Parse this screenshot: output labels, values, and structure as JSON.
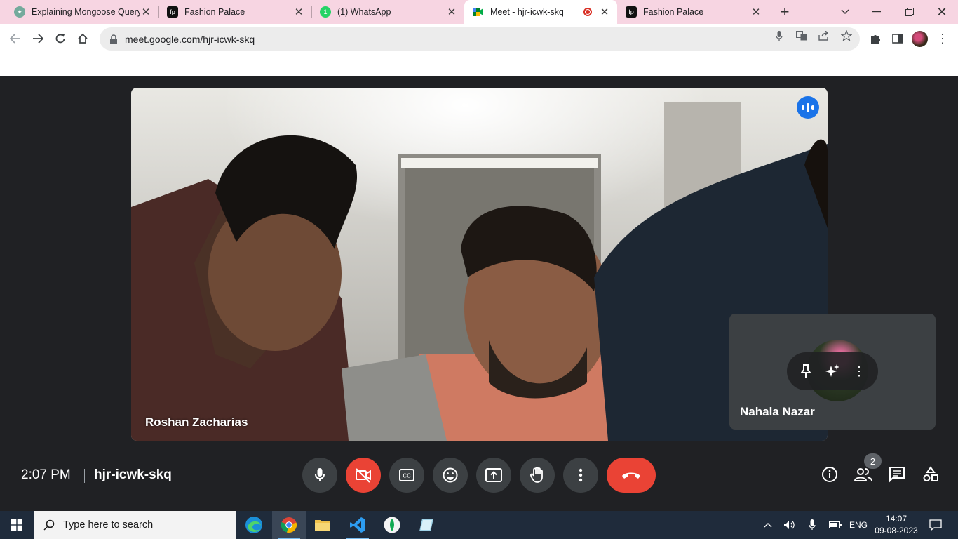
{
  "browser": {
    "tabs": [
      {
        "title": "Explaining Mongoose Query",
        "icon": "chatgpt-icon"
      },
      {
        "title": "Fashion Palace",
        "icon": "fashion-palace-icon"
      },
      {
        "title": "(1) WhatsApp",
        "icon": "whatsapp-icon"
      },
      {
        "title": "Meet - hjr-icwk-skq",
        "icon": "google-meet-icon",
        "active": true,
        "recording": true
      },
      {
        "title": "Fashion Palace",
        "icon": "fashion-palace-icon"
      }
    ],
    "url": "meet.google.com/hjr-icwk-skq"
  },
  "meet": {
    "main_participant": "Roshan Zacharias",
    "self_participant": "Nahala Nazar",
    "time": "2:07 PM",
    "meeting_code": "hjr-icwk-skq",
    "participant_count": "2",
    "colors": {
      "accent": "#1a73e8",
      "danger": "#ea4335",
      "button": "#3c4043",
      "background": "#202124"
    }
  },
  "taskbar": {
    "search_placeholder": "Type here to search",
    "language": "ENG",
    "time": "14:07",
    "date": "09-08-2023"
  }
}
